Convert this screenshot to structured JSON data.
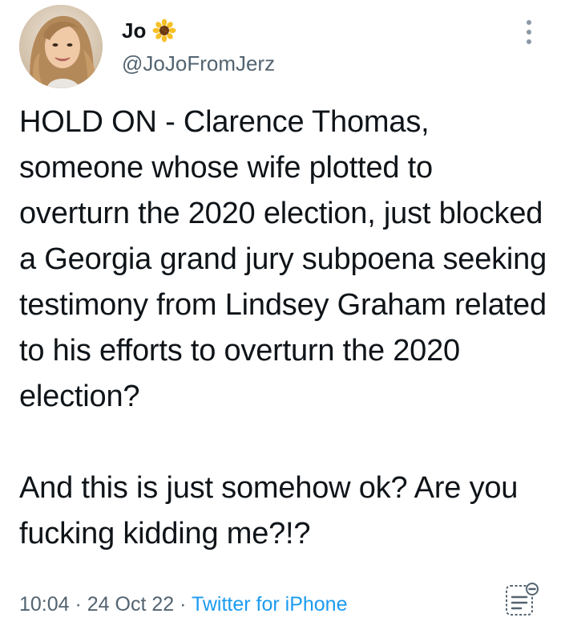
{
  "user": {
    "display_name": "Jo",
    "name_emoji": "sunflower-icon",
    "handle": "@JoJoFromJerz"
  },
  "tweet": {
    "paragraph_1": "HOLD ON - Clarence Thomas, someone whose wife plotted to overturn the 2020 election, just blocked a Georgia grand jury subpoena seeking testimony from Lindsey Graham related to his efforts to overturn the 2020 election?",
    "paragraph_2": "And this is just somehow ok? Are you fucking kidding me?!?"
  },
  "meta": {
    "time": "10:04",
    "separator": " · ",
    "date": "24 Oct 22",
    "source": "Twitter for iPhone"
  },
  "icons": {
    "more": "more-options-icon",
    "notes": "notes-icon"
  },
  "colors": {
    "text": "#0f1419",
    "secondary": "#536471",
    "link": "#1d9bf0"
  }
}
